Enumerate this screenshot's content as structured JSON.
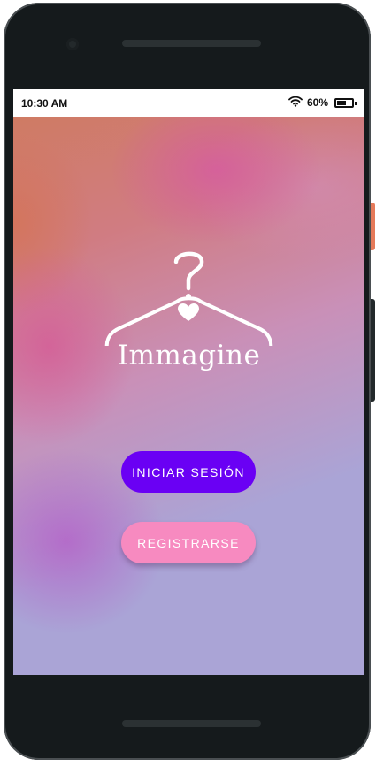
{
  "status_bar": {
    "time": "10:30 AM",
    "battery_percent": "60%",
    "battery_level": 0.6,
    "wifi_icon": "wifi-icon",
    "battery_icon": "battery-icon"
  },
  "logo": {
    "icon": "hanger-heart-icon",
    "text": "Immagine"
  },
  "buttons": {
    "login_label": "INICIAR SESIÓN",
    "register_label": "REGISTRARSE"
  },
  "colors": {
    "login_button": "#6a00f4",
    "register_button": "#f78ac0",
    "phone_frame": "#151a1c"
  }
}
